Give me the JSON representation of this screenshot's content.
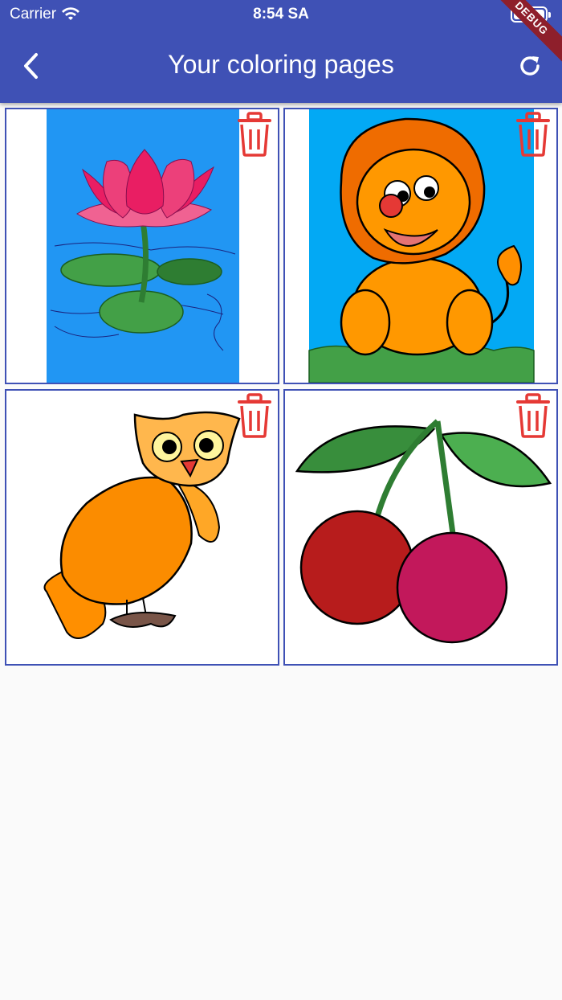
{
  "status_bar": {
    "carrier": "Carrier",
    "time": "8:54 SA"
  },
  "app_bar": {
    "title": "Your coloring pages",
    "debug_banner": "DEBUG"
  },
  "colors": {
    "primary": "#3f51b5",
    "delete": "#e53935"
  },
  "pages": [
    {
      "subject": "lotus flower",
      "icon": "trash-icon"
    },
    {
      "subject": "lion",
      "icon": "trash-icon"
    },
    {
      "subject": "owl",
      "icon": "trash-icon"
    },
    {
      "subject": "cherries",
      "icon": "trash-icon"
    }
  ]
}
